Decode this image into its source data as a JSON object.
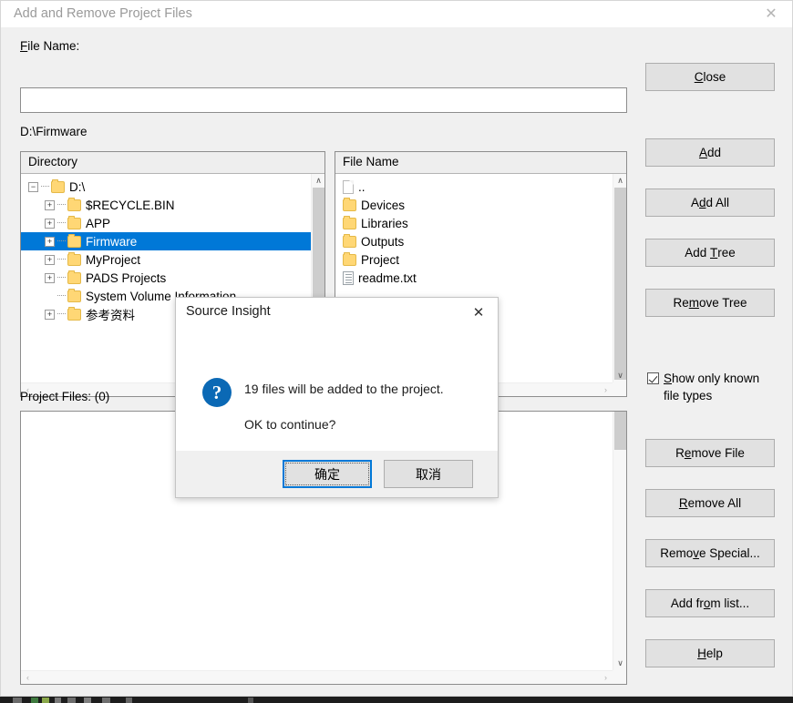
{
  "window": {
    "title": "Add and Remove Project Files",
    "close_icon": "close-icon",
    "close_glyph": "✕"
  },
  "form": {
    "file_name_label": "File Name:",
    "file_name_accel": "F",
    "file_name_value": "",
    "file_name_placeholder": "",
    "current_path": "D:\\Firmware"
  },
  "directory_panel": {
    "header": "Directory",
    "items": [
      {
        "label": "D:\\",
        "depth": 0,
        "expander": "collapse",
        "expander_glyph": "−",
        "icon": "folder-icon",
        "selected": false
      },
      {
        "label": "$RECYCLE.BIN",
        "depth": 1,
        "expander": "expand",
        "expander_glyph": "+",
        "icon": "folder-icon",
        "selected": false
      },
      {
        "label": "APP",
        "depth": 1,
        "expander": "expand",
        "expander_glyph": "+",
        "icon": "folder-icon",
        "selected": false
      },
      {
        "label": "Firmware",
        "depth": 1,
        "expander": "expand",
        "expander_glyph": "+",
        "icon": "folder-icon",
        "selected": true
      },
      {
        "label": "MyProject",
        "depth": 1,
        "expander": "expand",
        "expander_glyph": "+",
        "icon": "folder-icon",
        "selected": false
      },
      {
        "label": "PADS Projects",
        "depth": 1,
        "expander": "expand",
        "expander_glyph": "+",
        "icon": "folder-icon",
        "selected": false
      },
      {
        "label": "System Volume Information",
        "depth": 1,
        "expander": "none",
        "expander_glyph": "",
        "icon": "folder-icon",
        "selected": false
      },
      {
        "label": "参考资料",
        "depth": 1,
        "expander": "expand",
        "expander_glyph": "+",
        "icon": "folder-icon",
        "selected": false
      }
    ]
  },
  "file_panel": {
    "header": "File Name",
    "items": [
      {
        "label": "..",
        "icon": "page-icon"
      },
      {
        "label": "Devices",
        "icon": "folder-icon"
      },
      {
        "label": "Libraries",
        "icon": "folder-icon"
      },
      {
        "label": "Outputs",
        "icon": "folder-icon"
      },
      {
        "label": "Project",
        "icon": "folder-icon"
      },
      {
        "label": "readme.txt",
        "icon": "document-icon"
      }
    ]
  },
  "project_files": {
    "label": "Project Files: (0)",
    "count": 0,
    "items": []
  },
  "buttons": {
    "close": {
      "label": "Close",
      "accel": "C"
    },
    "add": {
      "label": "Add",
      "accel": "A"
    },
    "add_all": {
      "label": "Add All",
      "accel": "d"
    },
    "add_tree": {
      "label": "Add Tree",
      "accel": "T"
    },
    "remove_tree": {
      "label": "Remove Tree",
      "accel": "m"
    },
    "remove_file": {
      "label": "Remove File",
      "accel": "e"
    },
    "remove_all": {
      "label": "Remove All",
      "accel": "R"
    },
    "remove_special": {
      "label": "Remove Special...",
      "accel": "v"
    },
    "add_from_list": {
      "label": "Add from list...",
      "accel": "o"
    },
    "help": {
      "label": "Help",
      "accel": "H"
    }
  },
  "checkbox": {
    "label_line1": "Show only known",
    "label_line2": "file types",
    "accel": "S",
    "checked": true
  },
  "modal": {
    "title": "Source Insight",
    "close_glyph": "✕",
    "icon": "question-icon",
    "icon_glyph": "?",
    "message_line1": "19 files will be added to the project.",
    "message_line2": "OK to continue?",
    "ok_label": "确定",
    "cancel_label": "取消",
    "focused_button": "ok"
  },
  "scrollbars": {
    "up_glyph": "∧",
    "down_glyph": "∨",
    "left_glyph": "‹",
    "right_glyph": "›"
  },
  "colors": {
    "selection": "#0078d7",
    "focus_border": "#0078d7",
    "window_bg": "#f0f0f0",
    "folder": "#ffd775",
    "question_icon": "#0b69b5"
  }
}
